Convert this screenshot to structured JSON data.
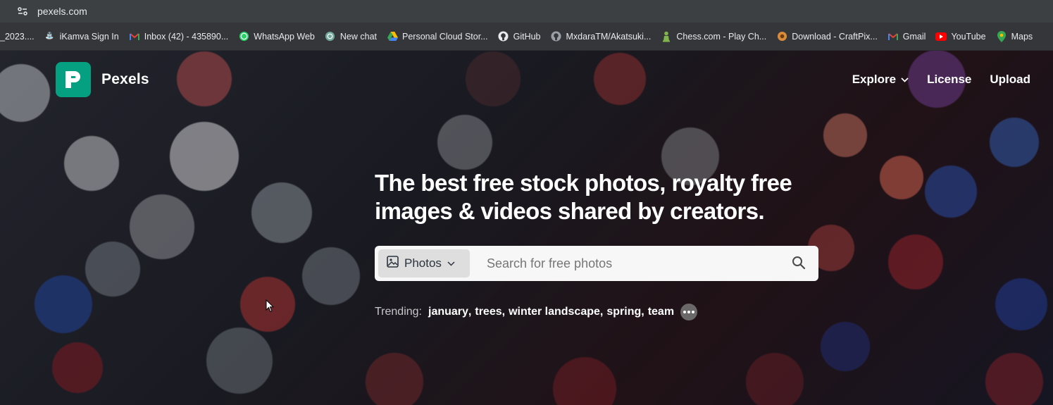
{
  "browser": {
    "url": "pexels.com",
    "bookmarks": [
      {
        "label": "_2023....",
        "icon": "none",
        "color": "#35363a"
      },
      {
        "label": "iKamva Sign In",
        "icon": "ikamva-icon",
        "color": "#5c8fd6"
      },
      {
        "label": "Inbox (42) - 435890...",
        "icon": "gmail-icon",
        "color": "#ea4335"
      },
      {
        "label": "WhatsApp Web",
        "icon": "whatsapp-icon",
        "color": "#25d366"
      },
      {
        "label": "New chat",
        "icon": "chatgpt-icon",
        "color": "#74aa9c"
      },
      {
        "label": "Personal Cloud Stor...",
        "icon": "google-drive-icon",
        "color": "#fbbc04"
      },
      {
        "label": "GitHub",
        "icon": "github-icon",
        "color": "#e8eaed"
      },
      {
        "label": "MxdaraTM/Akatsuki...",
        "icon": "github-icon",
        "color": "#e8eaed"
      },
      {
        "label": "Chess.com - Play Ch...",
        "icon": "chess-pawn-icon",
        "color": "#81b64c"
      },
      {
        "label": "Download - CraftPix...",
        "icon": "craftpix-icon",
        "color": "#d98b3a"
      },
      {
        "label": "Gmail",
        "icon": "gmail-icon",
        "color": "#ea4335"
      },
      {
        "label": "YouTube",
        "icon": "youtube-icon",
        "color": "#ff0000"
      },
      {
        "label": "Maps",
        "icon": "maps-icon",
        "color": "#34a853"
      }
    ]
  },
  "header": {
    "brand": "Pexels",
    "brand_color": "#05a081",
    "nav": {
      "explore": "Explore",
      "license": "License",
      "upload": "Upload"
    }
  },
  "hero": {
    "headline": "The best free stock photos, royalty free images & videos shared by creators."
  },
  "search": {
    "type_selected": "Photos",
    "placeholder": "Search for free photos",
    "value": ""
  },
  "trending": {
    "label": "Trending:",
    "tags": [
      "january",
      "trees",
      "winter landscape",
      "spring",
      "team"
    ]
  }
}
